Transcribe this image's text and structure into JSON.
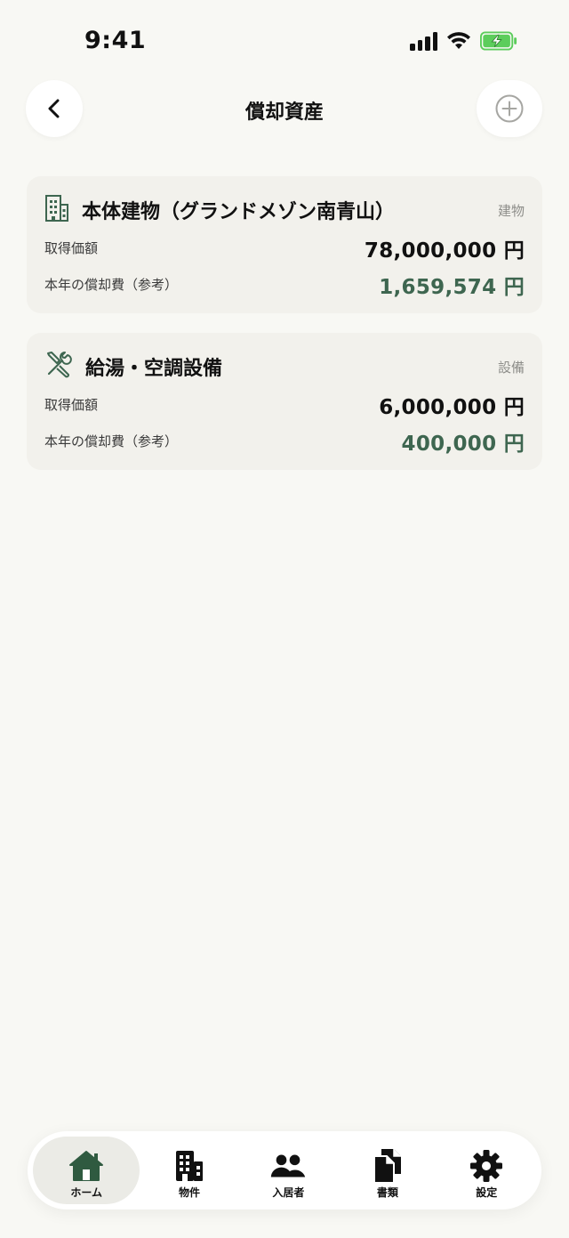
{
  "status_bar": {
    "time": "9:41"
  },
  "header": {
    "title": "償却資産"
  },
  "assets": [
    {
      "name": "本体建物（グランドメゾン南青山）",
      "category": "建物",
      "icon": "building-icon",
      "acquisition_label": "取得価額",
      "acquisition_value": "78,000,000 円",
      "depreciation_label": "本年の償却費（参考）",
      "depreciation_value": "1,659,574 円"
    },
    {
      "name": "給湯・空調設備",
      "category": "設備",
      "icon": "tools-icon",
      "acquisition_label": "取得価額",
      "acquisition_value": "6,000,000 円",
      "depreciation_label": "本年の償却費（参考）",
      "depreciation_value": "400,000 円"
    }
  ],
  "tab_bar": {
    "items": [
      {
        "label": "ホーム",
        "icon": "home-icon",
        "active": true
      },
      {
        "label": "物件",
        "icon": "building-icon",
        "active": false
      },
      {
        "label": "入居者",
        "icon": "people-icon",
        "active": false
      },
      {
        "label": "書類",
        "icon": "documents-icon",
        "active": false
      },
      {
        "label": "設定",
        "icon": "gear-icon",
        "active": false
      }
    ]
  },
  "colors": {
    "background": "#f8f8f4",
    "card": "#f2f1ec",
    "accent_green": "#3e6650",
    "home_icon_green": "#2f5a40",
    "battery_green": "#5ccd5c"
  }
}
